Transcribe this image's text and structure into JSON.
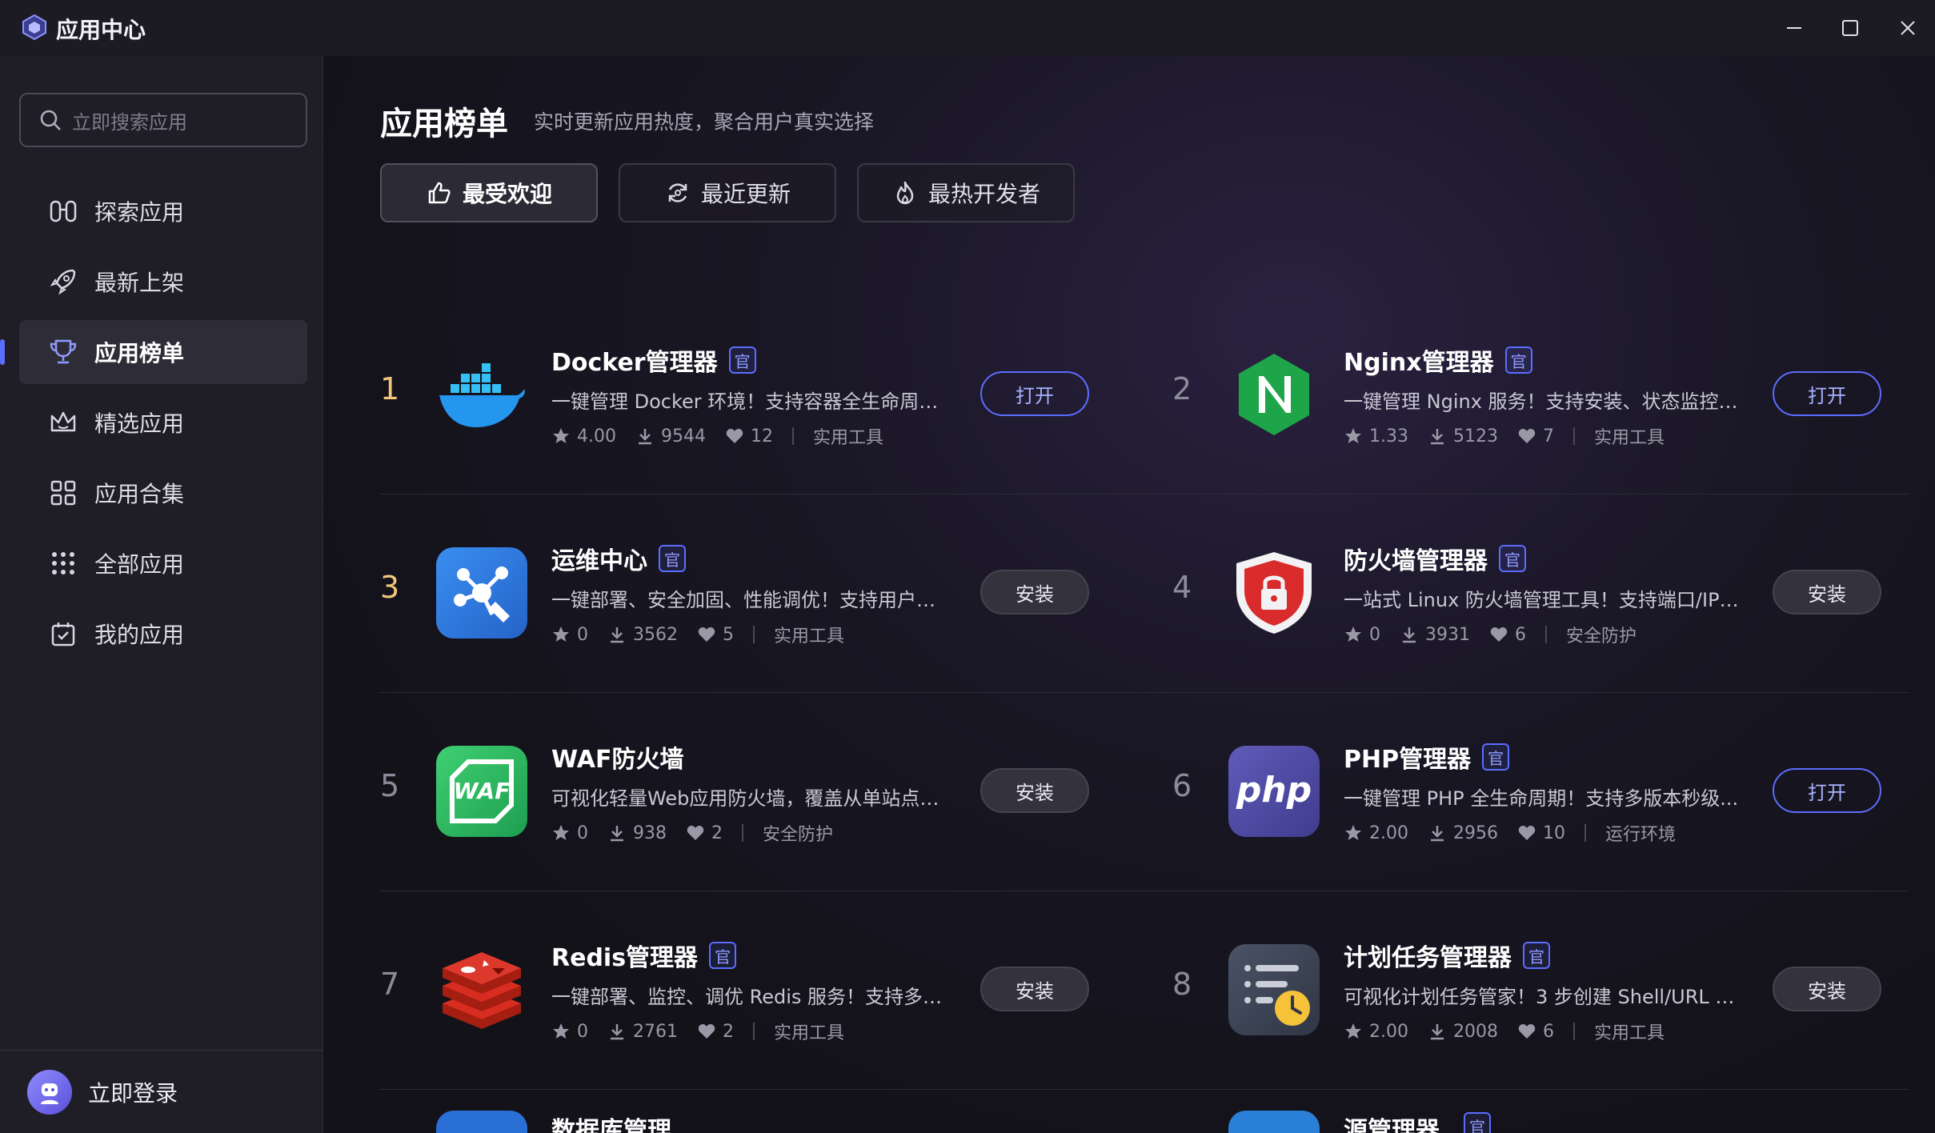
{
  "window": {
    "title": "应用中心"
  },
  "sidebar": {
    "search_placeholder": "立即搜索应用",
    "items": [
      {
        "label": "探索应用",
        "icon": "binoculars-icon"
      },
      {
        "label": "最新上架",
        "icon": "rocket-icon"
      },
      {
        "label": "应用榜单",
        "icon": "trophy-icon",
        "active": true
      },
      {
        "label": "精选应用",
        "icon": "crown-icon"
      },
      {
        "label": "应用合集",
        "icon": "grid-icon"
      },
      {
        "label": "全部应用",
        "icon": "dots-grid-icon"
      },
      {
        "label": "我的应用",
        "icon": "calendar-check-icon"
      }
    ],
    "login_label": "立即登录"
  },
  "main": {
    "title": "应用榜单",
    "subtitle": "实时更新应用热度，聚合用户真实选择",
    "tabs": [
      {
        "label": "最受欢迎",
        "icon": "thumbs-up-icon",
        "active": true
      },
      {
        "label": "最近更新",
        "icon": "refresh-icon"
      },
      {
        "label": "最热开发者",
        "icon": "flame-icon"
      }
    ],
    "apps": [
      {
        "rank": "1",
        "name": "Docker管理器",
        "official": "官",
        "desc": "一键管理 Docker 环境！支持容器全生命周期...",
        "rating": "4.00",
        "downloads": "9544",
        "likes": "12",
        "category": "实用工具",
        "action": "打开"
      },
      {
        "rank": "2",
        "name": "Nginx管理器",
        "official": "官",
        "desc": "一键管理 Nginx 服务！支持安装、状态监控、...",
        "rating": "1.33",
        "downloads": "5123",
        "likes": "7",
        "category": "实用工具",
        "action": "打开"
      },
      {
        "rank": "3",
        "name": "运维中心",
        "official": "官",
        "desc": "一键部署、安全加固、性能调优！支持用户权...",
        "rating": "0",
        "downloads": "3562",
        "likes": "5",
        "category": "实用工具",
        "action": "安装"
      },
      {
        "rank": "4",
        "name": "防火墙管理器",
        "official": "官",
        "desc": "一站式 Linux 防火墙管理工具！支持端口/IP规...",
        "rating": "0",
        "downloads": "3931",
        "likes": "6",
        "category": "安全防护",
        "action": "安装"
      },
      {
        "rank": "5",
        "name": "WAF防火墙",
        "official": "",
        "desc": "可视化轻量Web应用防火墙，覆盖从单站点到...",
        "rating": "0",
        "downloads": "938",
        "likes": "2",
        "category": "安全防护",
        "action": "安装"
      },
      {
        "rank": "6",
        "name": "PHP管理器",
        "official": "官",
        "desc": "一键管理 PHP 全生命周期！支持多版本秒级...",
        "rating": "2.00",
        "downloads": "2956",
        "likes": "10",
        "category": "运行环境",
        "action": "打开"
      },
      {
        "rank": "7",
        "name": "Redis管理器",
        "official": "官",
        "desc": "一键部署、监控、调优 Redis 服务！支持多版...",
        "rating": "0",
        "downloads": "2761",
        "likes": "2",
        "category": "实用工具",
        "action": "安装"
      },
      {
        "rank": "8",
        "name": "计划任务管理器",
        "official": "官",
        "desc": "可视化计划任务管家！3 步创建 Shell/URL 任...",
        "rating": "2.00",
        "downloads": "2008",
        "likes": "6",
        "category": "实用工具",
        "action": "安装"
      }
    ],
    "partial_apps": [
      {
        "name": "数据库管理"
      },
      {
        "name": "源管理器",
        "official": "官"
      }
    ]
  },
  "colors": {
    "accent": "#5b6dff",
    "rank_top": "#f1c77a",
    "background": "#131219",
    "sidebar": "#1f1e26"
  }
}
